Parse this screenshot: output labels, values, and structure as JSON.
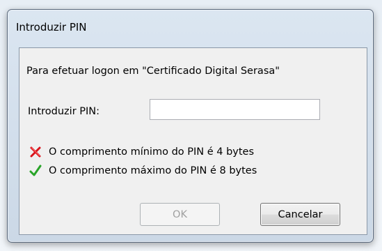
{
  "window": {
    "title": "Introduzir PIN"
  },
  "dialog": {
    "message": "Para efetuar logon em \"Certificado Digital Serasa\"",
    "pin_label": "Introduzir PIN:",
    "pin_value": "",
    "rules": [
      {
        "text": "O comprimento mínimo do PIN é 4 bytes",
        "status": "unmet",
        "icon": "red-x-icon",
        "color": "#d8131b"
      },
      {
        "text": "O comprimento máximo do PIN é 8 bytes",
        "status": "met",
        "icon": "green-check-icon",
        "color": "#28a428"
      }
    ],
    "ok_label": "OK",
    "ok_enabled": false,
    "cancel_label": "Cancelar"
  }
}
